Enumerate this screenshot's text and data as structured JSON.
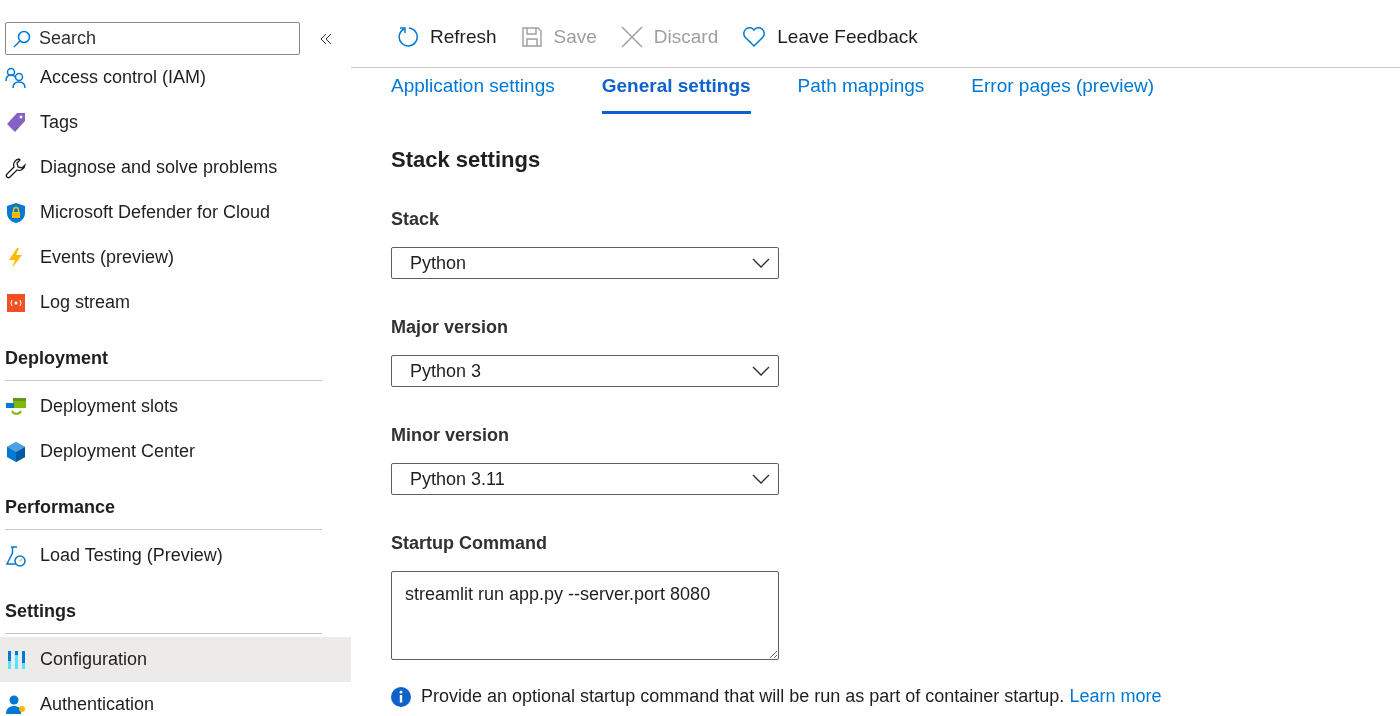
{
  "sidebar": {
    "search": {
      "placeholder": "Search"
    },
    "groups": [
      {
        "items": [
          {
            "label": "Access control (IAM)",
            "selected": false
          },
          {
            "label": "Tags",
            "selected": false
          },
          {
            "label": "Diagnose and solve problems",
            "selected": false
          },
          {
            "label": "Microsoft Defender for Cloud",
            "selected": false
          },
          {
            "label": "Events (preview)",
            "selected": false
          },
          {
            "label": "Log stream",
            "selected": false
          }
        ]
      },
      {
        "heading": "Deployment",
        "items": [
          {
            "label": "Deployment slots",
            "selected": false
          },
          {
            "label": "Deployment Center",
            "selected": false
          }
        ]
      },
      {
        "heading": "Performance",
        "items": [
          {
            "label": "Load Testing (Preview)",
            "selected": false
          }
        ]
      },
      {
        "heading": "Settings",
        "items": [
          {
            "label": "Configuration",
            "selected": true
          },
          {
            "label": "Authentication",
            "selected": false
          }
        ]
      }
    ]
  },
  "toolbar": [
    {
      "label": "Refresh",
      "disabled": false
    },
    {
      "label": "Save",
      "disabled": true
    },
    {
      "label": "Discard",
      "disabled": true
    },
    {
      "label": "Leave Feedback",
      "disabled": false
    }
  ],
  "tabs": [
    {
      "label": "Application settings",
      "selected": false
    },
    {
      "label": "General settings",
      "selected": true
    },
    {
      "label": "Path mappings",
      "selected": false
    },
    {
      "label": "Error pages (preview)",
      "selected": false
    }
  ],
  "section_title": "Stack settings",
  "fields": [
    {
      "kind": "select",
      "label": "Stack",
      "value": "Python"
    },
    {
      "kind": "select",
      "label": "Major version",
      "value": "Python 3"
    },
    {
      "kind": "select",
      "label": "Minor version",
      "value": "Python 3.11"
    },
    {
      "kind": "textarea",
      "label": "Startup Command",
      "value": "streamlit run app.py --server.port 8080"
    }
  ],
  "info": {
    "text": "Provide an optional startup command that will be run as part of container startup.",
    "link": "Learn more"
  }
}
